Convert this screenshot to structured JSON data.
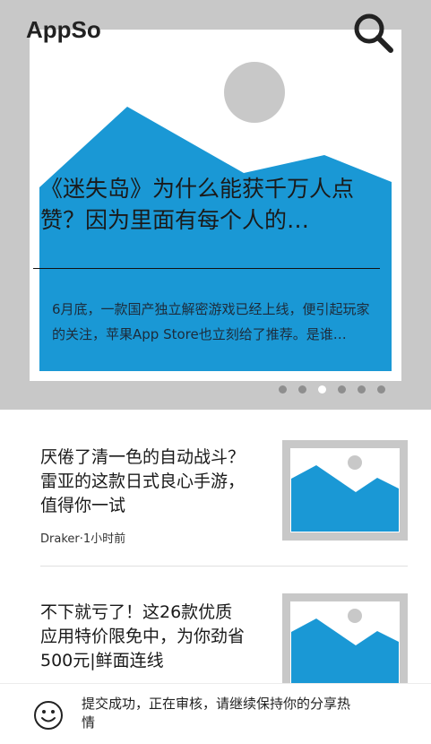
{
  "header": {
    "app_title": "AppSo",
    "search_icon": "search-icon"
  },
  "featured": {
    "title": "《迷失岛》为什么能获千万人点赞？因为里面有每个人的…",
    "summary": "6月底，一款国产独立解密游戏已经上线，便引起玩家的关注，苹果App Store也立刻给了推荐。是谁…",
    "image_icon": "image-placeholder-icon",
    "carousel_dots": 6,
    "carousel_active_index": 2
  },
  "articles": [
    {
      "title": "厌倦了清一色的自动战斗？雷亚的这款日式良心手游，值得你一试",
      "meta": "Draker·1小时前",
      "thumb_icon": "image-placeholder-icon"
    },
    {
      "title": "不下就亏了！这26款优质应用特价限免中，为你劲省500元|鲜面连线",
      "meta": "",
      "thumb_icon": "image-placeholder-icon"
    }
  ],
  "toast": {
    "icon": "smiley-icon",
    "message": "提交成功，正在审核，请继续保持你的分享热情"
  },
  "colors": {
    "accent_blue": "#1a98d5",
    "hero_background": "#c8c8c8",
    "placeholder_frame": "#c8c8c8"
  }
}
